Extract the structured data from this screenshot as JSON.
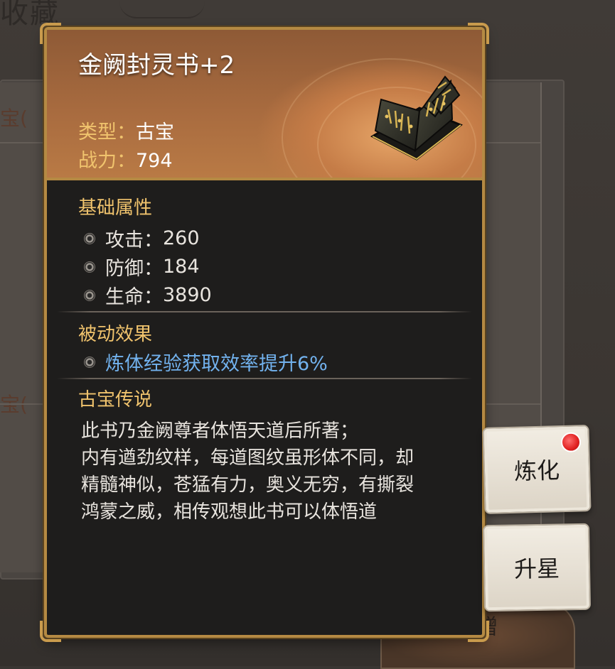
{
  "background": {
    "page_title": "收藏",
    "list_labels": [
      "宝(",
      "宝("
    ],
    "action_button": "转赠"
  },
  "item": {
    "name": "金阙封灵书+2",
    "type_label": "类型：",
    "type_value": "古宝",
    "power_label": "战力：",
    "power_value": "794",
    "image": "ancient-book-icon"
  },
  "base_stats": {
    "title": "基础属性",
    "items": [
      {
        "label": "攻击：",
        "value": "260"
      },
      {
        "label": "防御：",
        "value": "184"
      },
      {
        "label": "生命：",
        "value": "3890"
      }
    ]
  },
  "passive": {
    "title": "被动效果",
    "effect": "炼体经验获取效率提升6%"
  },
  "lore": {
    "title": "古宝传说",
    "text": "此书乃金阙尊者体悟天道后所著；\n内有遒劲纹样，每道图纹虽形体不同，却\n精髓神似，苍猛有力，奥义无穷，有撕裂\n鸿蒙之威，相传观想此书可以体悟道"
  },
  "actions": {
    "refine_label": "炼化",
    "star_label": "升星",
    "refine_has_notification": true
  },
  "colors": {
    "accent_gold": "#f0c36d",
    "border_gold": "#b58a43",
    "passive_blue": "#72b2ee",
    "notification_red": "#e02020"
  }
}
